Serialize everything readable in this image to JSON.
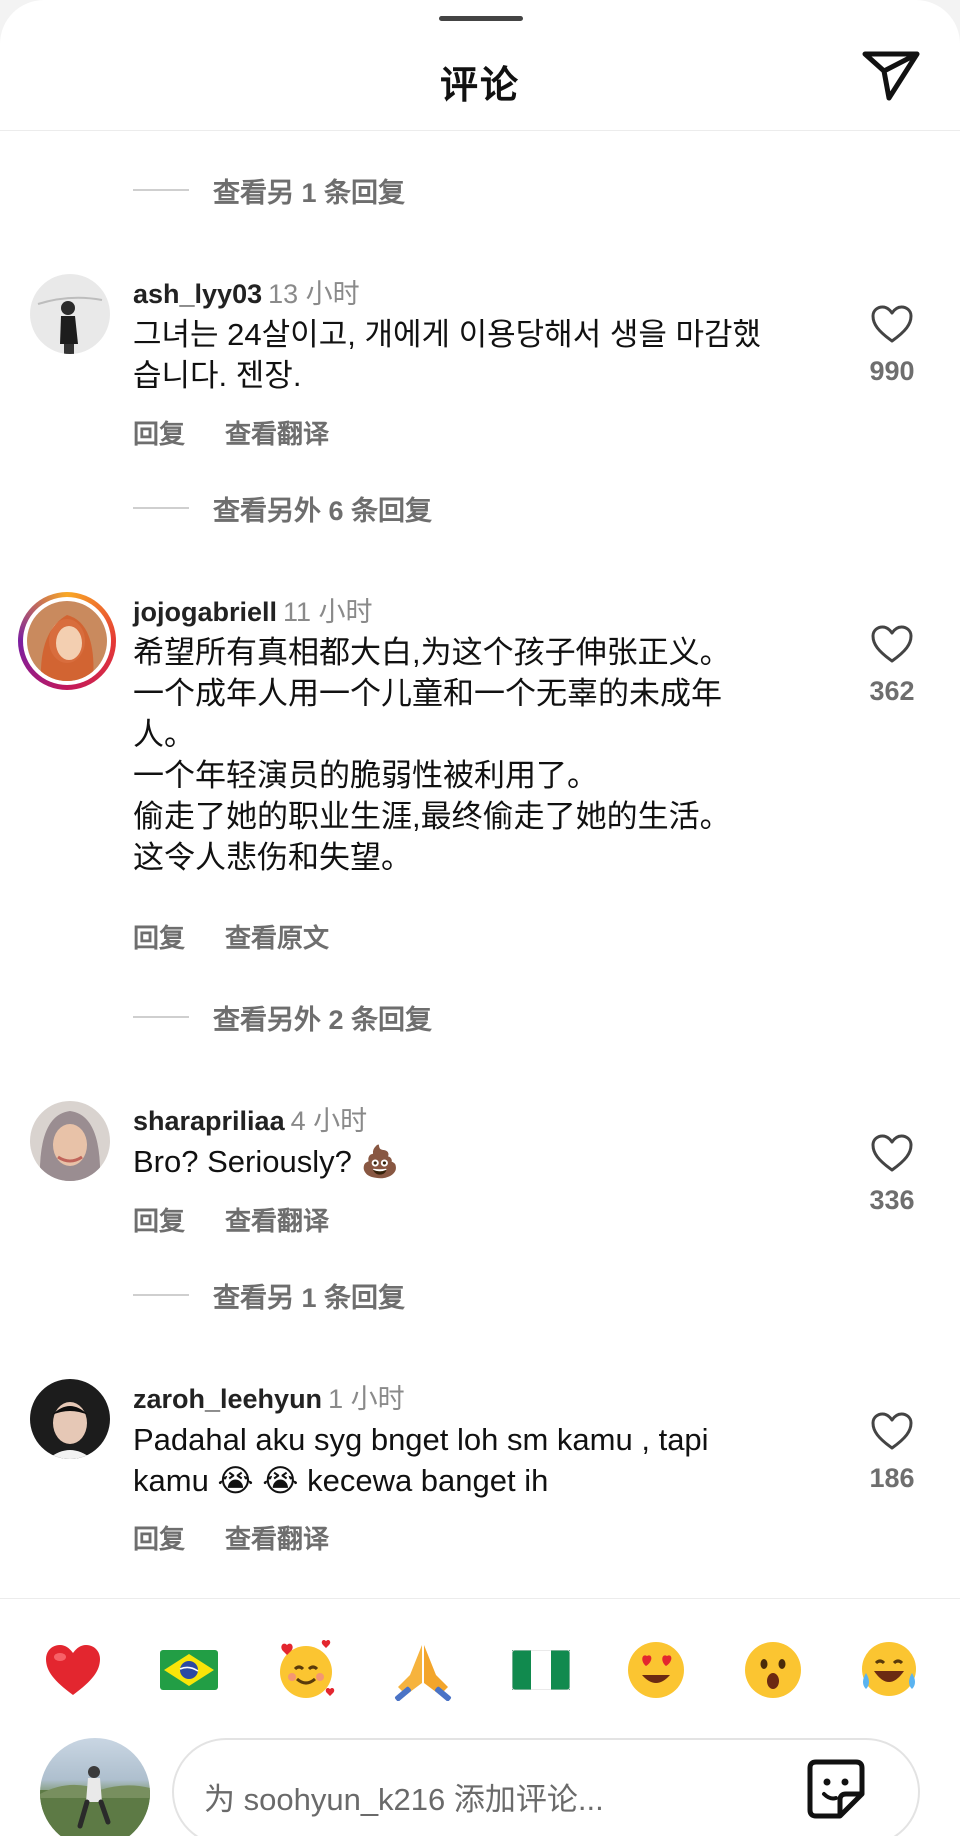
{
  "header": {
    "title": "评论"
  },
  "view_more": [
    "查看另 1 条回复",
    "查看另外 6 条回复",
    "查看另外 2 条回复",
    "查看另 1 条回复"
  ],
  "comments": [
    {
      "user": "ash_lyy03",
      "time": "13 小时",
      "lines": [
        "그녀는 24살이고, 개에게 이용당해서 생을 마감했",
        "습니다. 젠장."
      ],
      "reply": "回复",
      "translate": "查看翻译",
      "likes": "990"
    },
    {
      "user": "jojogabriell",
      "time": "11 小时",
      "lines": [
        "希望所有真相都大白,为这个孩子伸张正义。",
        "一个成年人用一个儿童和一个无辜的未成年",
        "人。",
        "一个年轻演员的脆弱性被利用了。",
        "偷走了她的职业生涯,最终偷走了她的生活。",
        "这令人悲伤和失望。"
      ],
      "reply": "回复",
      "translate": "查看原文",
      "likes": "362"
    },
    {
      "user": "sharapriliaa",
      "time": "4 小时",
      "lines": [
        "Bro? Seriously? 💩"
      ],
      "reply": "回复",
      "translate": "查看翻译",
      "likes": "336"
    },
    {
      "user": "zaroh_leehyun",
      "time": "1 小时",
      "lines": [
        "Padahal aku syg bnget loh sm kamu , tapi",
        "kamu 😭 😭 kecewa banget ih"
      ],
      "reply": "回复",
      "translate": "查看翻译",
      "likes": "186"
    }
  ],
  "emoji_bar": [
    "red-heart",
    "brazil-flag",
    "smiling-face-with-hearts",
    "folded-hands",
    "nigeria-flag",
    "heart-eyes",
    "astonished-face",
    "tears-of-joy"
  ],
  "composer": {
    "placeholder": "为 soohyun_k216 添加评论..."
  }
}
